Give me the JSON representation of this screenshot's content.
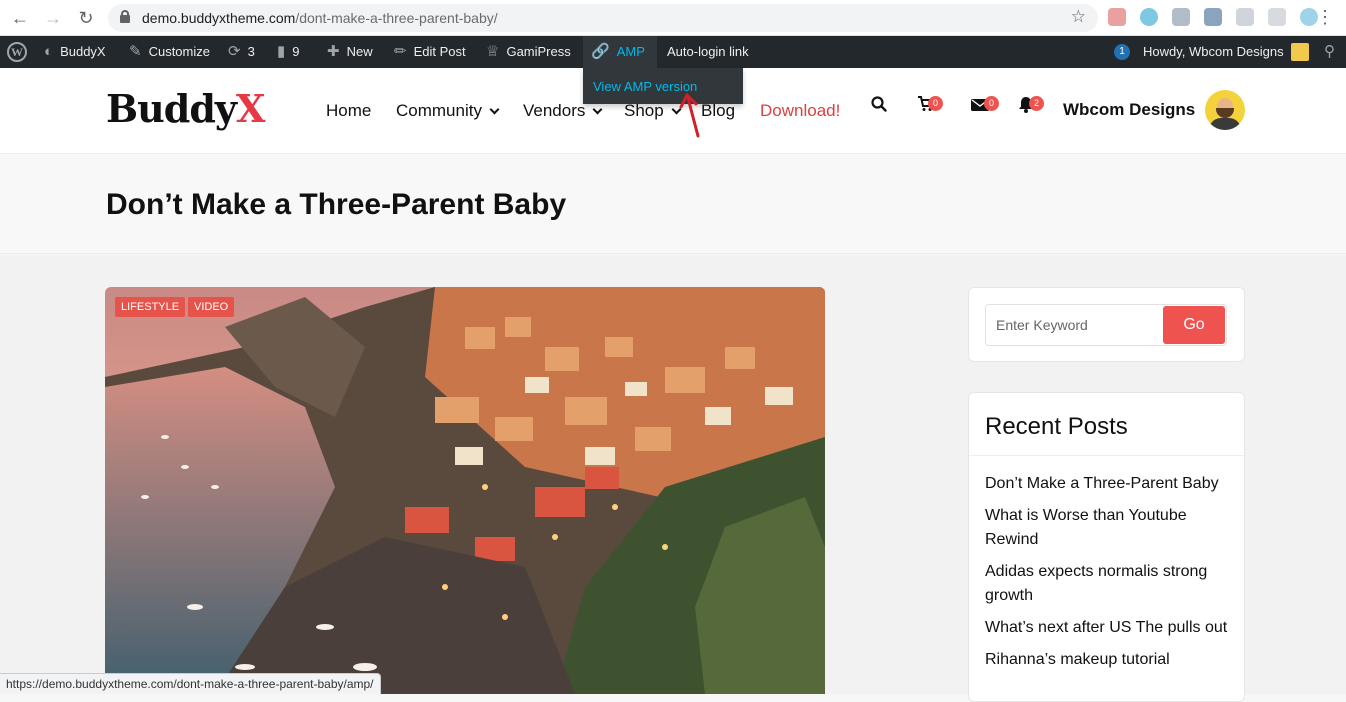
{
  "browser": {
    "url_domain": "demo.buddyxtheme.com",
    "url_path": "/dont-make-a-three-parent-baby/",
    "status_url": "https://demo.buddyxtheme.com/dont-make-a-three-parent-baby/amp/"
  },
  "adminbar": {
    "site_name": "BuddyX",
    "customize": "Customize",
    "updates_count": "3",
    "comments_count": "9",
    "new_label": "New",
    "edit_post": "Edit Post",
    "gamipress": "GamiPress",
    "amp": "AMP",
    "autologin": "Auto-login link",
    "notif_count": "1",
    "howdy": "Howdy, Wbcom Designs",
    "amp_dropdown_item": "View AMP version"
  },
  "header": {
    "logo_main": "Buddy",
    "logo_x": "X",
    "nav": {
      "home": "Home",
      "community": "Community",
      "vendors": "Vendors",
      "shop": "Shop",
      "blog": "Blog",
      "download": "Download!"
    },
    "cart_count": "0",
    "messages_count": "0",
    "notifications_count": "2",
    "user_name": "Wbcom Designs"
  },
  "page": {
    "title": "Don’t Make a Three-Parent Baby",
    "categories": [
      "LIFESTYLE",
      "VIDEO"
    ]
  },
  "sidebar": {
    "search_placeholder": "Enter Keyword",
    "search_button": "Go",
    "recent_title": "Recent Posts",
    "recent_posts": [
      "Don’t Make a Three-Parent Baby",
      "What is Worse than Youtube Rewind",
      "Adidas expects normalis strong growth",
      "What’s next after US The pulls out",
      "Rihanna’s makeup tutorial"
    ]
  },
  "colors": {
    "accent": "#ef5350",
    "amp_blue": "#00b9eb",
    "adminbar_bg": "#23282d"
  }
}
